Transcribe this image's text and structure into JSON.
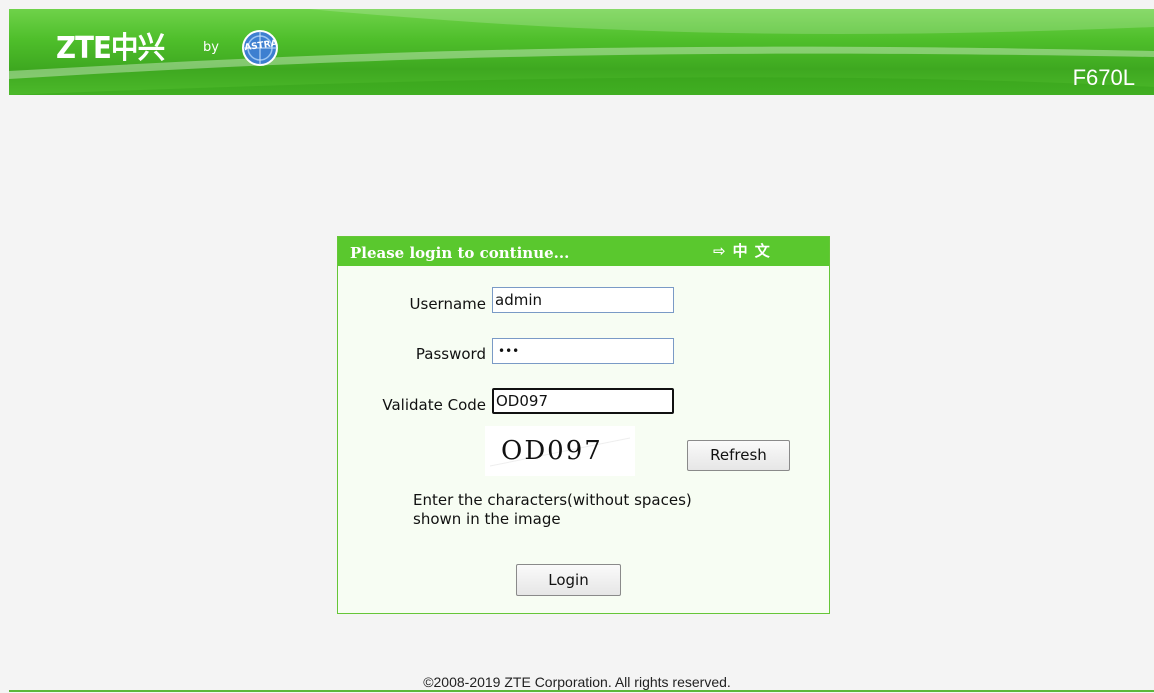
{
  "header": {
    "brand": "ZTE中兴",
    "by": "by",
    "partner": "ASTRA",
    "model": "F670L"
  },
  "login": {
    "title": "Please login to continue...",
    "lang_link": "中 文",
    "username_label": "Username",
    "username_value": "admin",
    "password_label": "Password",
    "password_mask": "•••",
    "validate_label": "Validate Code",
    "validate_value": "OD097",
    "captcha_text": "OD097",
    "refresh_label": "Refresh",
    "hint_line1": "Enter the characters(without spaces)",
    "hint_line2": "shown in the image",
    "login_label": "Login"
  },
  "footer": {
    "copyright": "©2008-2019 ZTE Corporation. All rights reserved."
  },
  "colors": {
    "brand_green": "#4fbf2b",
    "panel_header": "#5ac82e",
    "panel_border": "#66c638"
  }
}
